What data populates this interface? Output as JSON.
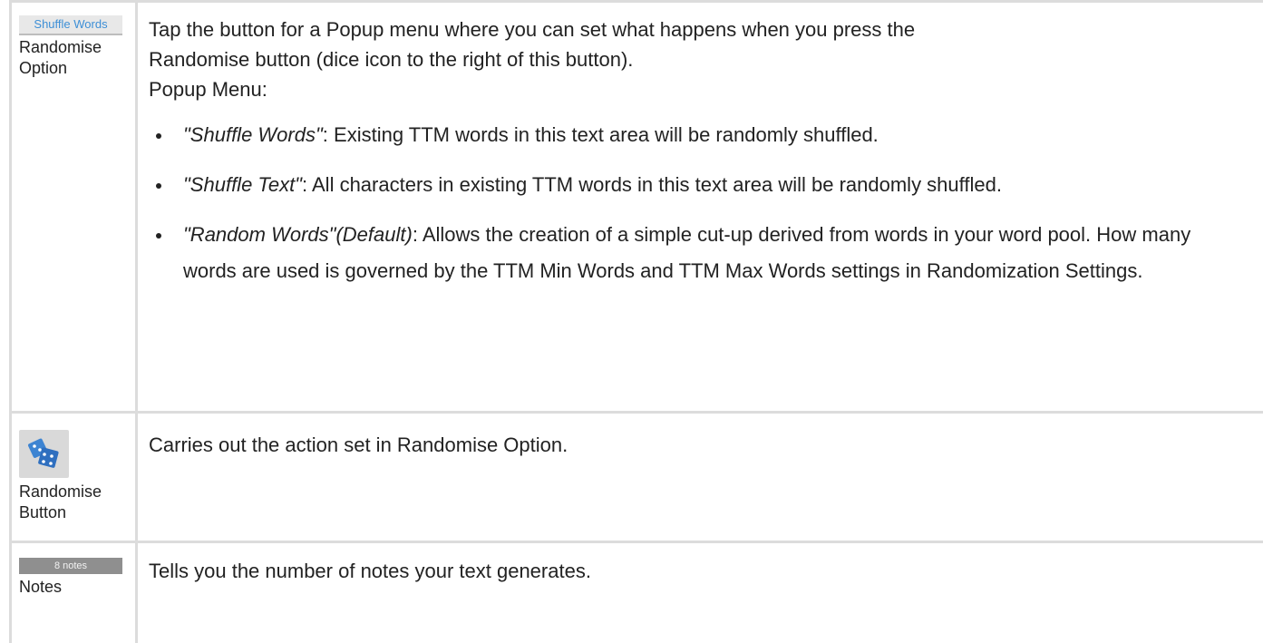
{
  "rows": {
    "randomise_option": {
      "button_label": "Shuffle Words",
      "label_line1": "Randomise",
      "label_line2": "Option",
      "desc_line1": "Tap the button for a Popup menu where you can set what happens when you press the",
      "desc_line2": "Randomise button (dice icon to the right of this button).",
      "popup_heading": "Popup Menu:",
      "options": [
        {
          "name": "\"Shuffle Words\"",
          "text": ": Existing TTM words in this text area will be randomly shuffled."
        },
        {
          "name": "\"Shuffle Text\"",
          "text": ": All characters in existing TTM words in this text area will be randomly shuffled."
        },
        {
          "name": "\"Random Words\"(Default)",
          "text": ": Allows the creation of a simple cut-up derived from words in your word pool. How many words are used is governed by the TTM Min Words and TTM Max Words settings in Randomization Settings."
        }
      ]
    },
    "randomise_button": {
      "icon": "dice-icon",
      "label_line1": "Randomise",
      "label_line2": "Button",
      "desc": "Carries out the action set in Randomise Option."
    },
    "notes": {
      "button_label": "8 notes",
      "label": "Notes",
      "desc": "Tells you the number of notes your text generates."
    }
  },
  "colors": {
    "border": "#dcdcdc",
    "shuffle_button_text": "#3d8fd6",
    "dice": "#3d84d2",
    "notes_bar": "#8f8f8f"
  }
}
